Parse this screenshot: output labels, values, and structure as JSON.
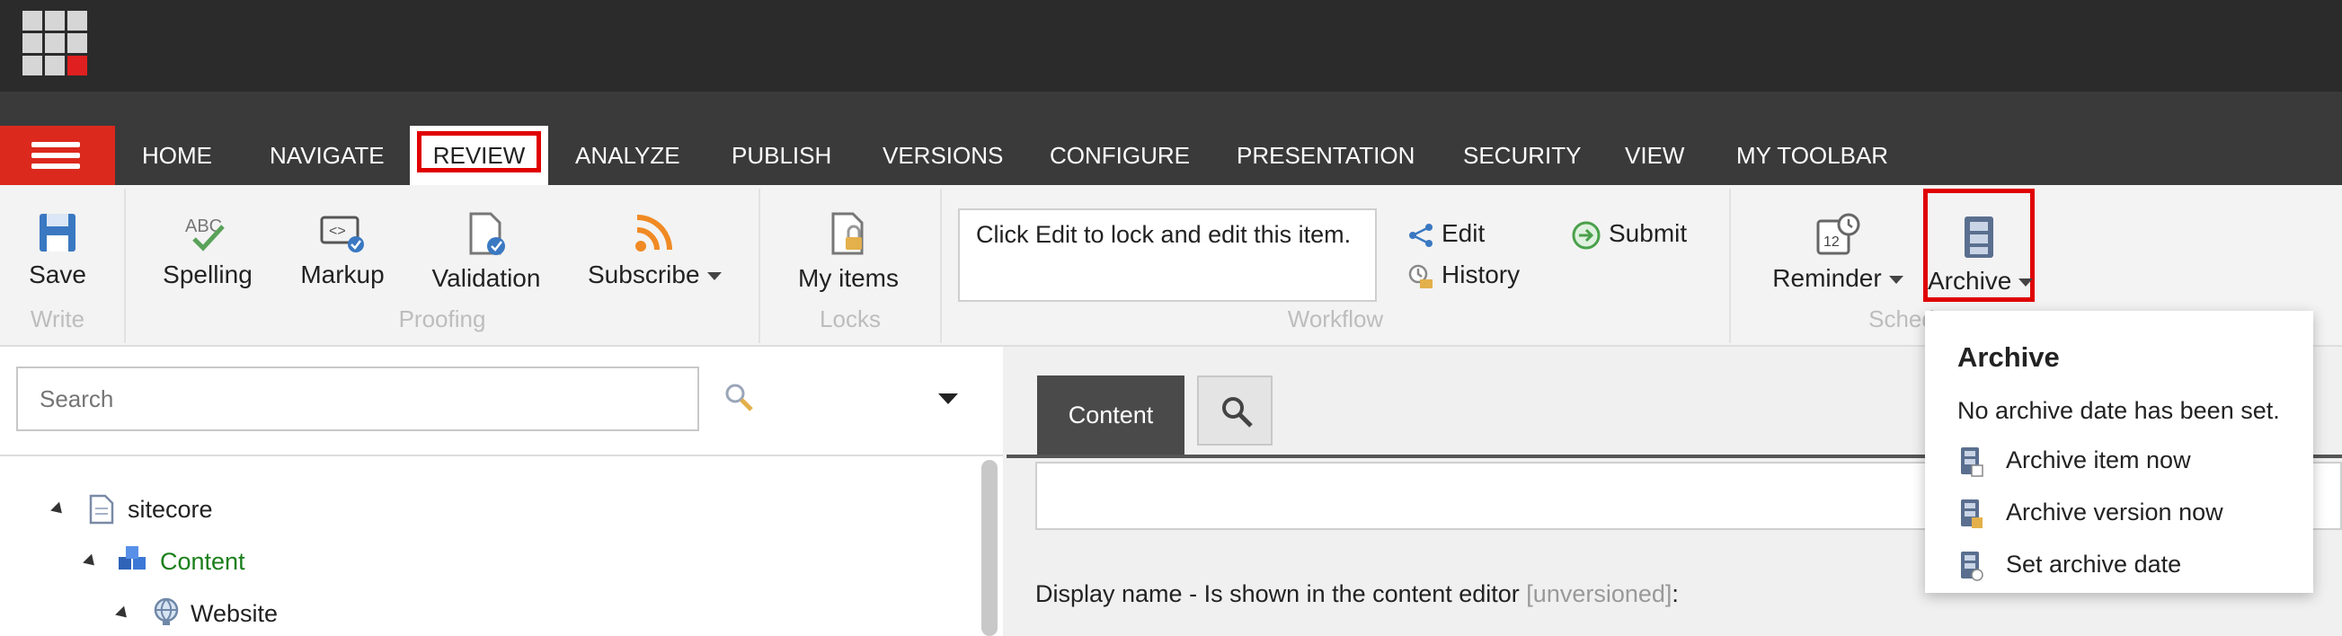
{
  "tabs": [
    {
      "label": "HOME"
    },
    {
      "label": "NAVIGATE"
    },
    {
      "label": "REVIEW"
    },
    {
      "label": "ANALYZE"
    },
    {
      "label": "PUBLISH"
    },
    {
      "label": "VERSIONS"
    },
    {
      "label": "CONFIGURE"
    },
    {
      "label": "PRESENTATION"
    },
    {
      "label": "SECURITY"
    },
    {
      "label": "VIEW"
    },
    {
      "label": "MY TOOLBAR"
    }
  ],
  "ribbon": {
    "save": "Save",
    "spelling": "Spelling",
    "markup": "Markup",
    "validation": "Validation",
    "subscribe": "Subscribe",
    "my_items": "My items",
    "workflow_text": "Click Edit to lock and edit this item.",
    "edit": "Edit",
    "history": "History",
    "submit": "Submit",
    "reminder": "Reminder",
    "archive": "Archive",
    "groups": {
      "write": "Write",
      "proofing": "Proofing",
      "locks": "Locks",
      "workflow": "Workflow",
      "schedule": "Sched"
    }
  },
  "search": {
    "placeholder": "Search"
  },
  "tree": [
    {
      "label": "sitecore"
    },
    {
      "label": "Content"
    },
    {
      "label": "Website"
    }
  ],
  "editor": {
    "content_tab": "Content",
    "display_name_label": "Display name - Is shown in the content editor",
    "display_name_note": "[unversioned]",
    "display_name_colon": ":"
  },
  "archive_menu": {
    "title": "Archive",
    "subtitle": "No archive date has been set.",
    "items": [
      {
        "label": "Archive item now"
      },
      {
        "label": "Archive version now"
      },
      {
        "label": "Set archive date"
      }
    ]
  },
  "colors": {
    "accent_red": "#dc291e",
    "highlight": "#e00000",
    "topbar": "#2b2b2b",
    "tabbar": "#3a3a3a",
    "content_green": "#1a7f1a"
  }
}
